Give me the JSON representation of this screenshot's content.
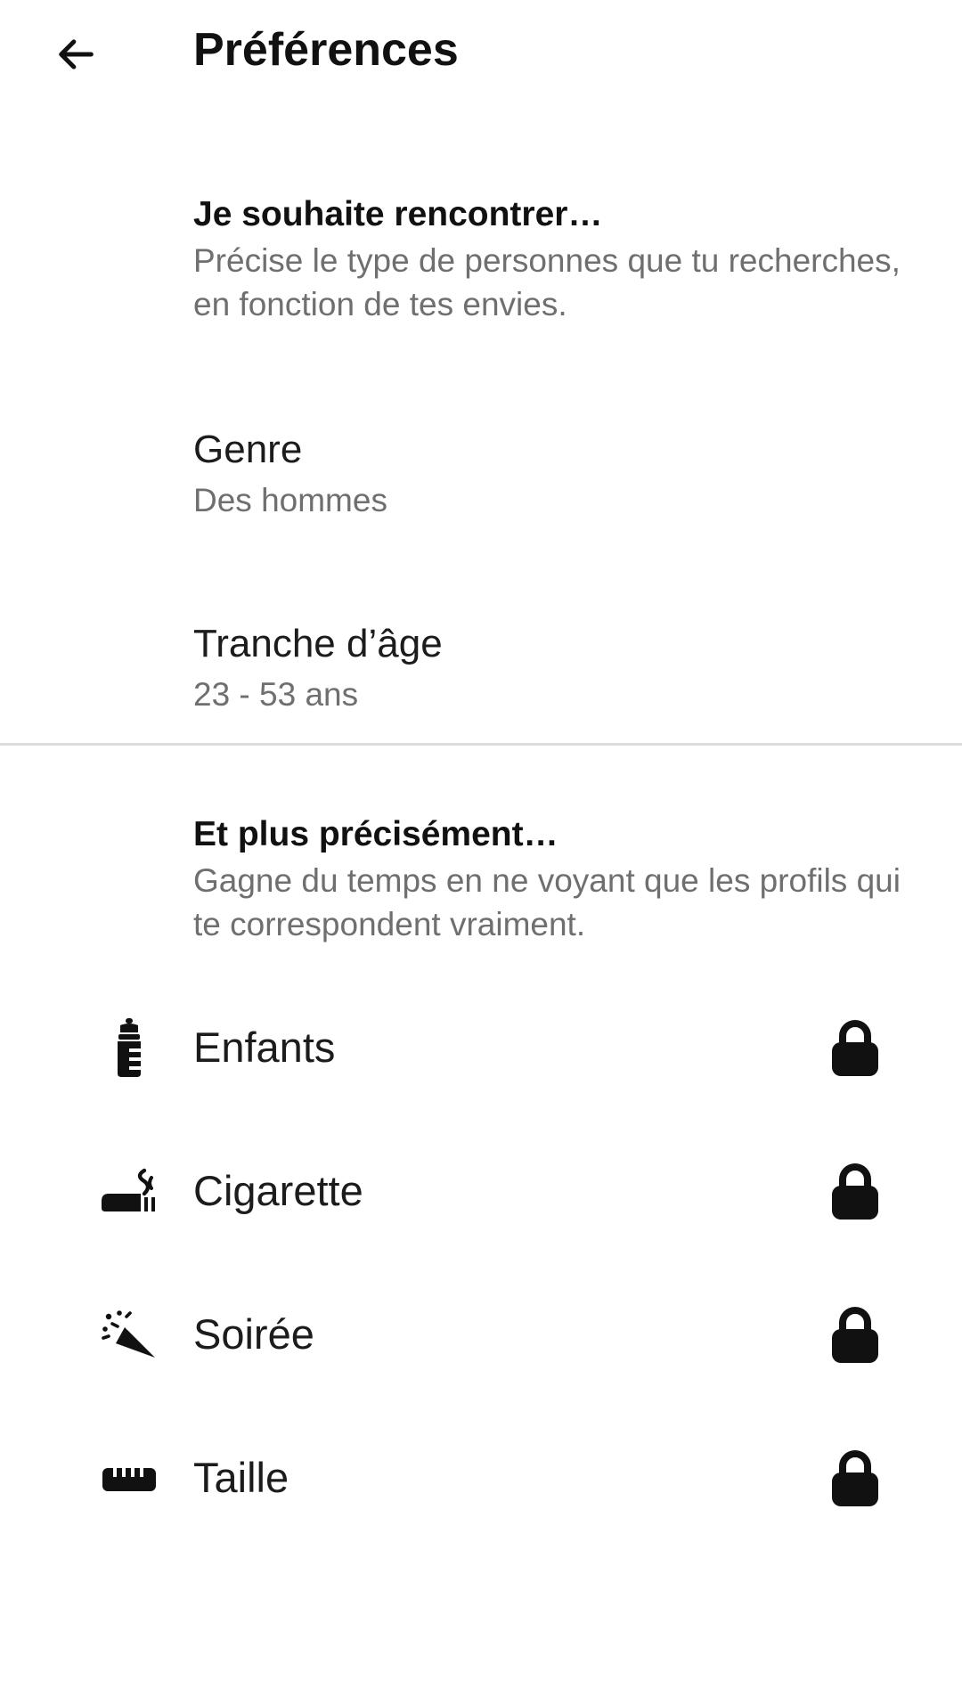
{
  "header": {
    "back_icon": "arrow-left-icon",
    "title": "Préférences"
  },
  "meet_section": {
    "title": "Je souhaite rencontrer…",
    "description": "Précise le type de personnes que tu recherches, en fonction de tes envies."
  },
  "preferences": [
    {
      "label": "Genre",
      "value": "Des hommes"
    },
    {
      "label": "Tranche d’âge",
      "value": "23 - 53 ans"
    }
  ],
  "details_section": {
    "title": "Et plus précisément…",
    "description": "Gagne du temps en ne voyant que les profils qui te correspondent vraiment."
  },
  "locked_filters": [
    {
      "label": "Enfants",
      "icon": "baby-bottle-icon",
      "locked_icon": "lock-icon"
    },
    {
      "label": "Cigarette",
      "icon": "cigarette-icon",
      "locked_icon": "lock-icon"
    },
    {
      "label": "Soirée",
      "icon": "party-popper-icon",
      "locked_icon": "lock-icon"
    },
    {
      "label": "Taille",
      "icon": "ruler-icon",
      "locked_icon": "lock-icon"
    }
  ],
  "colors": {
    "text_primary": "#1c1c1c",
    "text_secondary": "#6f6f6f",
    "divider": "#dcdcdc",
    "background": "#ffffff"
  }
}
